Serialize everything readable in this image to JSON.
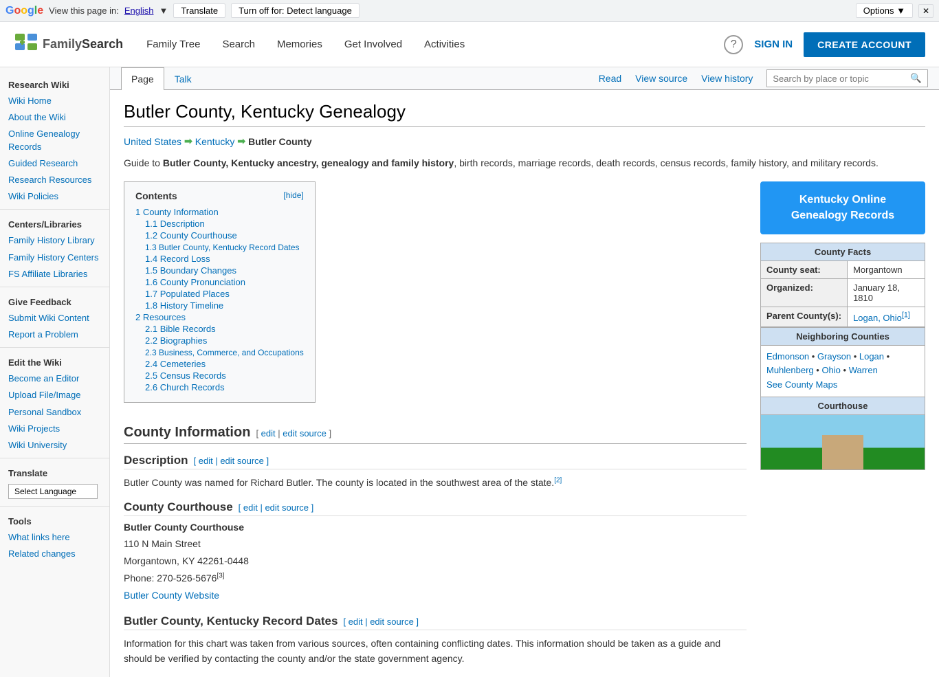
{
  "translate_bar": {
    "label": "View this page in:",
    "language_link": "English",
    "translate_btn": "Translate",
    "turnoff_btn": "Turn off for: Detect language",
    "options_btn": "Options ▼",
    "close_btn": "✕"
  },
  "nav": {
    "logo_text_family": "Family",
    "logo_text_search": "Search",
    "links": [
      {
        "label": "Family Tree",
        "href": "#"
      },
      {
        "label": "Search",
        "href": "#"
      },
      {
        "label": "Memories",
        "href": "#"
      },
      {
        "label": "Get Involved",
        "href": "#"
      },
      {
        "label": "Activities",
        "href": "#"
      }
    ],
    "sign_in": "SIGN IN",
    "create_account": "CREATE ACCOUNT"
  },
  "sidebar": {
    "section1_title": "Research Wiki",
    "links1": [
      {
        "label": "Wiki Home"
      },
      {
        "label": "About the Wiki"
      },
      {
        "label": "Online Genealogy Records"
      },
      {
        "label": "Guided Research"
      },
      {
        "label": "Research Resources"
      },
      {
        "label": "Wiki Policies"
      }
    ],
    "section2_title": "Centers/Libraries",
    "links2": [
      {
        "label": "Family History Library"
      },
      {
        "label": "Family History Centers"
      },
      {
        "label": "FS Affiliate Libraries"
      }
    ],
    "section3_title": "Give Feedback",
    "links3": [
      {
        "label": "Submit Wiki Content"
      },
      {
        "label": "Report a Problem"
      }
    ],
    "section4_title": "Edit the Wiki",
    "links4": [
      {
        "label": "Become an Editor"
      },
      {
        "label": "Upload File/Image"
      },
      {
        "label": "Personal Sandbox"
      },
      {
        "label": "Wiki Projects"
      },
      {
        "label": "Wiki University"
      }
    ],
    "section5_title": "Translate",
    "select_language": "Select Language",
    "section6_title": "Tools",
    "links6": [
      {
        "label": "What links here"
      },
      {
        "label": "Related changes"
      }
    ]
  },
  "page_tabs": {
    "page": "Page",
    "talk": "Talk",
    "read": "Read",
    "view_source": "View source",
    "view_history": "View history",
    "search_placeholder": "Search by place or topic"
  },
  "page": {
    "title": "Butler County, Kentucky Genealogy",
    "breadcrumb": {
      "us": "United States",
      "ky": "Kentucky",
      "current": "Butler County"
    },
    "intro": {
      "prefix": "Guide to ",
      "bold_text": "Butler County, Kentucky ancestry, genealogy and family history",
      "suffix": ", birth records, marriage records, death records, census records, family history, and military records."
    }
  },
  "contents": {
    "header": "Contents",
    "hide_label": "[hide]",
    "items": [
      {
        "num": "1",
        "label": "County Information",
        "indent": 0
      },
      {
        "num": "1.1",
        "label": "Description",
        "indent": 1
      },
      {
        "num": "1.2",
        "label": "County Courthouse",
        "indent": 1
      },
      {
        "num": "1.3",
        "label": "Butler County, Kentucky Record Dates",
        "indent": 1
      },
      {
        "num": "1.4",
        "label": "Record Loss",
        "indent": 1
      },
      {
        "num": "1.5",
        "label": "Boundary Changes",
        "indent": 1
      },
      {
        "num": "1.6",
        "label": "County Pronunciation",
        "indent": 1
      },
      {
        "num": "1.7",
        "label": "Populated Places",
        "indent": 1
      },
      {
        "num": "1.8",
        "label": "History Timeline",
        "indent": 1
      },
      {
        "num": "2",
        "label": "Resources",
        "indent": 0
      },
      {
        "num": "2.1",
        "label": "Bible Records",
        "indent": 1
      },
      {
        "num": "2.2",
        "label": "Biographies",
        "indent": 1
      },
      {
        "num": "2.3",
        "label": "Business, Commerce, and Occupations",
        "indent": 1
      },
      {
        "num": "2.4",
        "label": "Cemeteries",
        "indent": 1
      },
      {
        "num": "2.5",
        "label": "Census Records",
        "indent": 1
      },
      {
        "num": "2.6",
        "label": "Church Records",
        "indent": 1
      }
    ]
  },
  "county_info": {
    "section_title": "County Information",
    "edit": "[",
    "edit_link": "edit",
    "pipe": " | ",
    "edit_source_link": "edit source",
    "close": " ]",
    "description_title": "Description",
    "description_edit": "[ edit | edit source ]",
    "description_text": "Butler County was named for Richard Butler. The county is located in the southwest area of the state.",
    "description_ref": "[2]",
    "courthouse_title": "County Courthouse",
    "courthouse_edit": "[ edit | edit source ]",
    "courthouse_name": "Butler County Courthouse",
    "courthouse_address1": "110 N Main Street",
    "courthouse_city": "Morgantown, KY 42261-0448",
    "courthouse_phone": "Phone: 270-526-5676",
    "courthouse_phone_ref": "[3]",
    "courthouse_website": "Butler County Website",
    "record_dates_title": "Butler County, Kentucky Record Dates",
    "record_dates_edit": "[ edit | edit source ]",
    "record_dates_text": "Information for this chart was taken from various sources, often containing conflicting dates. This information should be taken as a guide and should be verified by contacting the county and/or the state government agency."
  },
  "ky_records_btn": "Kentucky Online\nGenealogy Records",
  "county_facts": {
    "header": "County Facts",
    "rows": [
      {
        "label": "County seat:",
        "value": "Morgantown"
      },
      {
        "label": "Organized:",
        "value": "January 18, 1810"
      },
      {
        "label": "Parent County(s):",
        "value": "Logan, Ohio",
        "ref": "[1]"
      }
    ]
  },
  "neighboring_counties": {
    "header": "Neighboring Counties",
    "counties": "Edmonson • Grayson • Logan • Muhlenberg • Ohio • Warren",
    "map_link": "See County Maps"
  },
  "courthouse_section": {
    "header": "Courthouse"
  }
}
